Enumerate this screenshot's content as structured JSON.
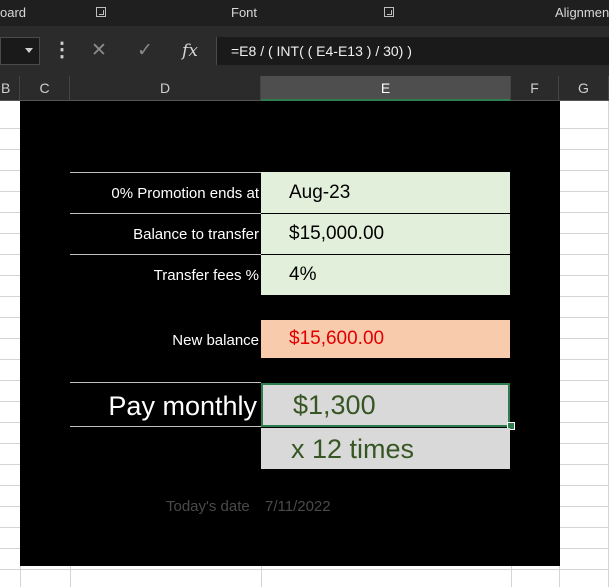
{
  "ribbon": {
    "groups": [
      "oard",
      "Font",
      "Alignmen"
    ]
  },
  "formula_bar": {
    "name_box": "",
    "more_icon": "⋮",
    "cancel_icon": "✕",
    "enter_icon": "✓",
    "fx_label": "fx",
    "formula": "=E8 / ( INT( ( E4-E13 ) / 30) )"
  },
  "columns": [
    "B",
    "C",
    "D",
    "E",
    "F",
    "G"
  ],
  "selected_column": "E",
  "sheet": {
    "promo_label": "0% Promotion ends at",
    "promo_value": "Aug-23",
    "balance_label": "Balance to transfer",
    "balance_value": "$15,000.00",
    "fees_label": "Transfer fees %",
    "fees_value": "4%",
    "new_balance_label": "New balance",
    "new_balance_value": "$15,600.00",
    "pay_label": "Pay monthly",
    "pay_value": "$1,300",
    "times_value": "x 12 times",
    "today_label": "Today's date",
    "today_value": "7/11/2022"
  },
  "colors": {
    "panel": "#000000",
    "input_fill": "#e2efda",
    "result_fill": "#f8cbad",
    "result_text": "#e00000",
    "pay_fill": "#d9d9d9",
    "pay_text": "#375623",
    "selection": "#2e7d4f"
  }
}
